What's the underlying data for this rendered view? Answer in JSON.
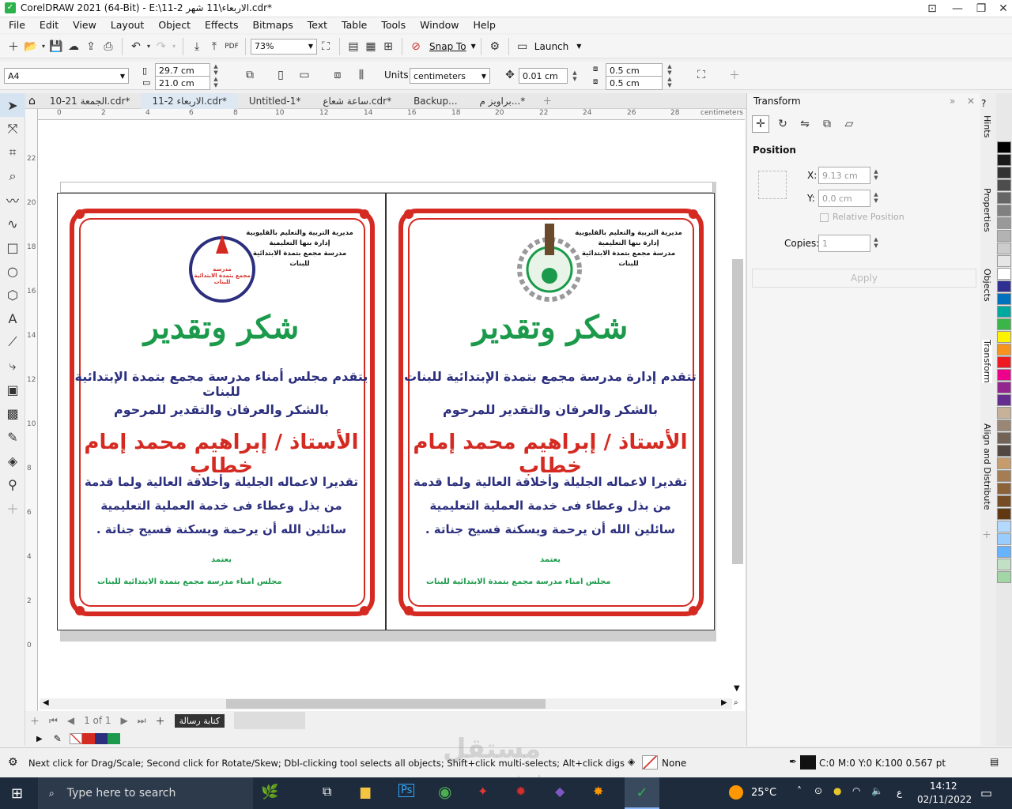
{
  "window": {
    "title": "CorelDRAW 2021 (64-Bit) - E:\\11-2 الاربعاء\\11 شهر.cdr*"
  },
  "menu": [
    "File",
    "Edit",
    "View",
    "Layout",
    "Object",
    "Effects",
    "Bitmaps",
    "Text",
    "Table",
    "Tools",
    "Window",
    "Help"
  ],
  "standard_toolbar": {
    "zoom": "73%",
    "snap_to": "Snap To",
    "launch": "Launch"
  },
  "property_bar": {
    "page_size": "A4",
    "width": "29.7 cm",
    "height": "21.0 cm",
    "units_label": "Units:",
    "units": "centimeters",
    "nudge": "0.01 cm",
    "dup_x": "0.5 cm",
    "dup_y": "0.5 cm"
  },
  "tabs": [
    "10-21 الجمعة.cdr*",
    "11-2 الاربعاء.cdr*",
    "Untitled-1*",
    "ساعة شعاع.cdr*",
    "Backup...",
    "براويز م...*"
  ],
  "ruler": {
    "unit": "centimeters",
    "h_ticks": [
      "0",
      "2",
      "4",
      "6",
      "8",
      "10",
      "12",
      "14",
      "16",
      "18",
      "20",
      "22",
      "24",
      "26",
      "28"
    ],
    "v_ticks": [
      "22",
      "20",
      "18",
      "16",
      "14",
      "12",
      "10",
      "8",
      "6",
      "4",
      "2",
      "0"
    ]
  },
  "certificates": [
    {
      "school_block": [
        "مديرية التربية والتعليم بالقليوبية",
        "إدارة بنها التعليمية",
        "مدرسة مجمع بتمدة الابتدائية",
        "للبنات"
      ],
      "logo_text": [
        "مدرسة",
        "مجمع بتمدة الابتدائية",
        "للبنات"
      ],
      "heading": "شكر وتقدير",
      "line1": "يتقدم مجلس أمناء مدرسة مجمع بتمدة الإبتدائية للبنات",
      "line2": "بالشكر والعرفان والتقدير للمرحوم",
      "name": "الأستاذ / إبراهيم محمد إمام خطاب",
      "line3": "تقديرا لاعماله الجليلة وأخلاقة العالية ولما قدمة",
      "line4": "من بذل وعطاء فى خدمة العملية التعليمية",
      "line5": "سائلين الله أن يرحمة ويسكنة فسيح جناتة .",
      "approve": "يعتمد",
      "signer": "مجلس امناء مدرسة مجمع بتمدة الابتدائية للبنات"
    },
    {
      "school_block": [
        "مديرية التربية والتعليم بالقليوبية",
        "إدارة بنها التعليمية",
        "مدرسة مجمع بتمدة الابتدائية",
        "للبنات"
      ],
      "heading": "شكر وتقدير",
      "line1": "تتقدم إدارة مدرسة مجمع بتمدة الإبتدائية للبنات",
      "line2": "بالشكر والعرفان والتقدير للمرحوم",
      "name": "الأستاذ / إبراهيم محمد إمام خطاب",
      "line3": "تقديرا لاعماله الجليلة وأخلاقة العالية ولما قدمة",
      "line4": "من بذل وعطاء فى خدمة العملية التعليمية",
      "line5": "سائلين الله أن يرحمة ويسكنة فسيح جناتة .",
      "approve": "يعتمد",
      "signer": "مجلس امناء مدرسة مجمع بتمدة الابتدائية للبنات"
    }
  ],
  "docker": {
    "title": "Transform",
    "section": "Position",
    "x_label": "X:",
    "x": "9.13 cm",
    "y_label": "Y:",
    "y": "0.0 cm",
    "relative": "Relative Position",
    "copies_label": "Copies:",
    "copies": "1",
    "apply": "Apply"
  },
  "docker_tabs": [
    "Hints",
    "Properties",
    "Objects",
    "Transform",
    "Align and Distribute"
  ],
  "pages": {
    "counter": "1 of 1",
    "page_tab": "كتابة رسالة"
  },
  "status": {
    "hint": "Next click for Drag/Scale; Second click for Rotate/Skew; Dbl-clicking tool selects all objects; Shift+click multi-selects; Alt+click digs",
    "fill": "None",
    "outline": "C:0 M:0 Y:0 K:100  0.567 pt"
  },
  "taskbar": {
    "search": "Type here to search",
    "temp": "25°C",
    "lang": "ع",
    "time": "14:12",
    "date": "02/11/2022"
  },
  "watermark": {
    "text": "مستقل",
    "url": "mostaql.com"
  },
  "colors": {
    "red": "#d42a22",
    "green": "#1a9a4a",
    "navy": "#2b2f7d",
    "palette": [
      "#000000",
      "#1a1a1a",
      "#333333",
      "#4d4d4d",
      "#666666",
      "#808080",
      "#999999",
      "#b3b3b3",
      "#cccccc",
      "#e6e6e6",
      "#ffffff",
      "#2e3192",
      "#0071bc",
      "#00a99d",
      "#39b54a",
      "#fff200",
      "#f7941d",
      "#ed1c24",
      "#ec008c",
      "#92278f",
      "#662d91",
      "#c7b299",
      "#998675",
      "#736357",
      "#534741",
      "#c69c6d",
      "#a67c52",
      "#8c6239",
      "#754c24",
      "#603913",
      "#b3d9ff",
      "#99ccff",
      "#66b3ff",
      "#c2e0c6",
      "#a3d6a7"
    ]
  }
}
